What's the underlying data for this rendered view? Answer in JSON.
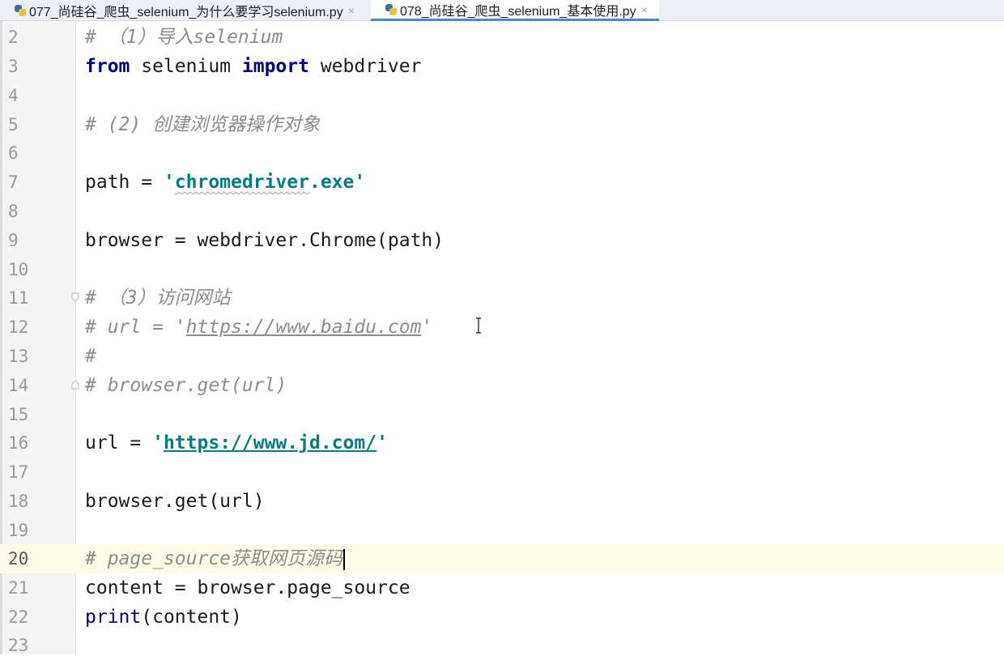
{
  "tabs": [
    {
      "label": "077_尚硅谷_爬虫_selenium_为什么要学习selenium.py",
      "active": false
    },
    {
      "label": "078_尚硅谷_爬虫_selenium_基本使用.py",
      "active": true
    }
  ],
  "close_glyph": "×",
  "current_line": 20,
  "lines": [
    {
      "n": "2",
      "t1": "# （1）导入selenium"
    },
    {
      "n": "3",
      "kw1": "from",
      "t1": " selenium ",
      "kw2": "import",
      "t2": " webdriver"
    },
    {
      "n": "4"
    },
    {
      "n": "5",
      "t1": "# (2) 创建浏览器操作对象"
    },
    {
      "n": "6"
    },
    {
      "n": "7",
      "t1": "path = ",
      "s1": "'",
      "s2": "chromedriver",
      "s3": ".exe'"
    },
    {
      "n": "8"
    },
    {
      "n": "9",
      "t1": "browser = webdriver.Chrome(path)"
    },
    {
      "n": "10"
    },
    {
      "n": "11",
      "t1": "# （3）访问网站"
    },
    {
      "n": "12",
      "t1": "# url = '",
      "u": "https://www.baidu.com",
      "t2": "'"
    },
    {
      "n": "13",
      "t1": "#"
    },
    {
      "n": "14",
      "t1": "# browser.get(url)"
    },
    {
      "n": "15"
    },
    {
      "n": "16",
      "t1": "url = ",
      "s1": "'",
      "u": "https://www.jd.com/",
      "s3": "'"
    },
    {
      "n": "17"
    },
    {
      "n": "18",
      "t1": "browser.get(url)"
    },
    {
      "n": "19"
    },
    {
      "n": "20",
      "t1": "# page_source获取网页源码"
    },
    {
      "n": "21",
      "t1": "content = browser.page_source"
    },
    {
      "n": "22",
      "b1": "print",
      "t1": "(content)"
    },
    {
      "n": "23"
    }
  ]
}
